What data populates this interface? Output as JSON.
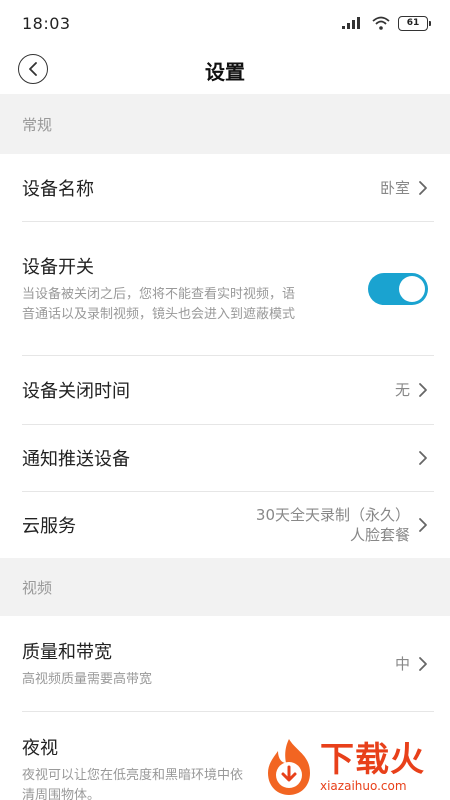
{
  "status_bar": {
    "time": "18:03",
    "battery": "61"
  },
  "nav": {
    "title": "设置"
  },
  "sections": {
    "general": "常规",
    "video": "视频"
  },
  "rows": {
    "device_name": {
      "label": "设备名称",
      "value": "卧室"
    },
    "device_switch": {
      "label": "设备开关",
      "sub_line1": "当设备被关闭之后，您将不能查看实时视频，语",
      "sub_line2": "音通话以及录制视频，镜头也会进入到遮蔽模式",
      "toggle_on": true
    },
    "off_time": {
      "label": "设备关闭时间",
      "value": "无"
    },
    "notify_devices": {
      "label": "通知推送设备"
    },
    "cloud_service": {
      "label": "云服务",
      "value_line1": "30天全天录制（永久）",
      "value_line2": "人脸套餐"
    },
    "quality": {
      "label": "质量和带宽",
      "sub": "高视频质量需要高带宽",
      "value": "中"
    },
    "night_vision": {
      "label": "夜视",
      "sub_line1": "夜视可以让您在低亮度和黑暗环境中依",
      "sub_line2": "清周围物体。"
    }
  },
  "watermark": {
    "cn": "下载火",
    "en": "xiazaihuo.com"
  },
  "colors": {
    "accent": "#1aa3d0",
    "watermark": "#e8401a",
    "section_bg": "#f2f2f2"
  }
}
